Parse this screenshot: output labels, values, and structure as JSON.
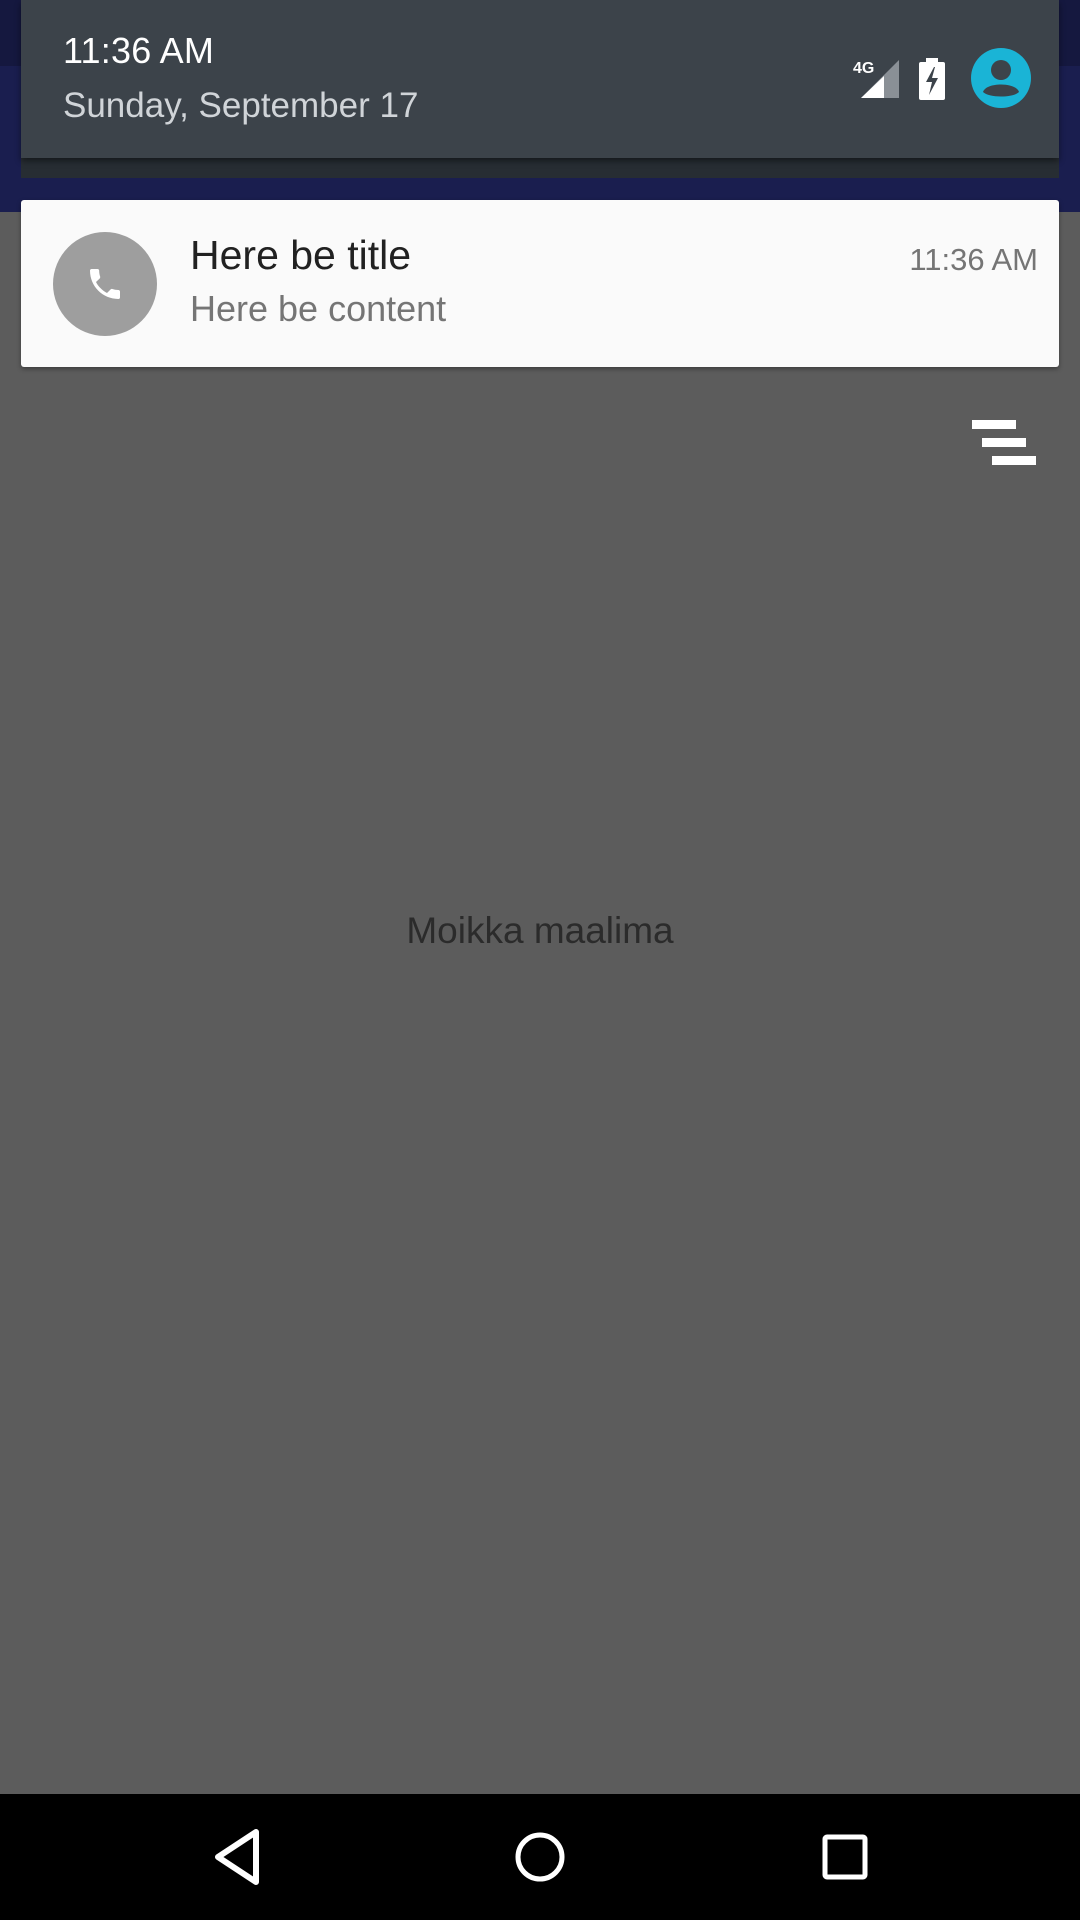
{
  "status_header": {
    "time": "11:36 AM",
    "date": "Sunday, September 17",
    "network_label": "4G",
    "icons": [
      "signal-4g-icon",
      "battery-charging-icon",
      "user-avatar-icon"
    ],
    "accent_color": "#1ab4d6"
  },
  "notification": {
    "icon": "phone-icon",
    "title": "Here be title",
    "content": "Here be content",
    "time": "11:36 AM"
  },
  "shade": {
    "clear_all_icon": "clear-all-icon"
  },
  "app": {
    "center_text": "Moikka maalima"
  },
  "navbar": {
    "buttons": [
      "back-icon",
      "home-icon",
      "recents-icon"
    ]
  }
}
